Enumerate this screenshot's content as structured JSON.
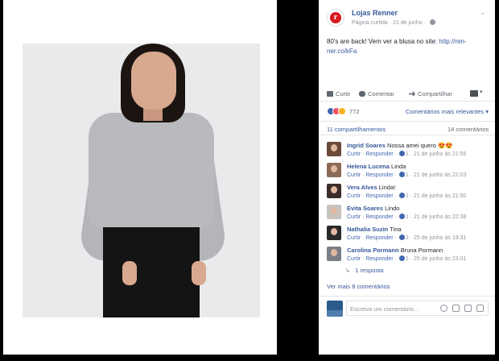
{
  "post": {
    "page_name": "Lojas Renner",
    "meta_label": "Página curtida",
    "date": "21 de junho",
    "text": "80's are back! Vem ver a blusa no site: ",
    "link": "http://ren-ner.co/kFa",
    "logo_letter": "r"
  },
  "actions": {
    "like": "Curtir",
    "comment": "Comentar",
    "share": "Compartilhar"
  },
  "stats": {
    "reactions_count": "772",
    "relevance": "Comentários mais relevantes ▾",
    "shares": "11 compartilhamentos",
    "comments": "14 comentários"
  },
  "comments": [
    {
      "name": "Ingrid Soares",
      "text": "Nossa amei quero 😍😍",
      "likes": "1",
      "date": "21 de junho às 21:55"
    },
    {
      "name": "Helena Lucena",
      "text": "Linda",
      "likes": "1",
      "date": "21 de junho às 22:03"
    },
    {
      "name": "Vera Alves",
      "text": "Linda!",
      "likes": "1",
      "date": "21 de junho às 21:50"
    },
    {
      "name": "Evita Soares",
      "text": "Lindo",
      "likes": "1",
      "date": "21 de junho às 22:38"
    },
    {
      "name": "Nathalia Suzin",
      "text": "Tina",
      "likes": "2",
      "date": "25 de junho às 19:31"
    },
    {
      "name": "Carolina Pormann",
      "text": "Bruna Pormann",
      "likes": "1",
      "date": "25 de junho às 23:01"
    }
  ],
  "comment_actions": {
    "like": "Curtir",
    "reply": "Responder"
  },
  "replies_link": "1 resposta",
  "more_comments": "Ver mais 8 comentários",
  "input": {
    "placeholder": "Escreva um comentário..."
  },
  "colors": {
    "link": "#365899",
    "brand": "#d71920",
    "like_blue": "#4267b2"
  }
}
